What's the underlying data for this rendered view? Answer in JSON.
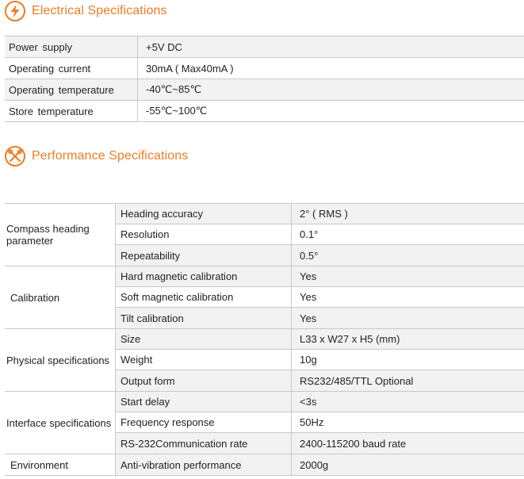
{
  "electrical": {
    "title": "Electrical Specifications",
    "icon": "lightning-icon",
    "rows": [
      {
        "label": "Power supply",
        "value": "+5V DC"
      },
      {
        "label": "Operating current",
        "value": "30mA ( Max40mA )"
      },
      {
        "label": "Operating temperature",
        "value": "-40℃~85℃"
      },
      {
        "label": "Store temperature",
        "value": "-55℃~100℃"
      }
    ]
  },
  "performance": {
    "title": "Performance Specifications",
    "icon": "tools-icon",
    "groups": [
      {
        "label": "Compass heading parameter",
        "rows": [
          {
            "name": "Heading accuracy",
            "value": "2° ( RMS )"
          },
          {
            "name": "Resolution",
            "value": "0.1°"
          },
          {
            "name": "Repeatability",
            "value": "0.5°"
          }
        ]
      },
      {
        "label": "Calibration",
        "rows": [
          {
            "name": "Hard magnetic calibration",
            "value": "Yes"
          },
          {
            "name": "Soft magnetic calibration",
            "value": "Yes"
          },
          {
            "name": "Tilt calibration",
            "value": "Yes"
          }
        ]
      },
      {
        "label": "Physical specifications",
        "rows": [
          {
            "name": "Size",
            "value": "L33 x W27 x H5 (mm)"
          },
          {
            "name": "Weight",
            "value": "10g"
          },
          {
            "name": "Output form",
            "value": "RS232/485/TTL Optional"
          }
        ]
      },
      {
        "label": "Interface specifications",
        "rows": [
          {
            "name": "Start delay",
            "value": "<3s"
          },
          {
            "name": "Frequency response",
            "value": "50Hz"
          },
          {
            "name": "RS-232Communication rate",
            "value": "2400-115200 baud rate"
          }
        ]
      },
      {
        "label": "Environment",
        "rows": [
          {
            "name": "Anti-vibration performance",
            "value": "2000g"
          }
        ]
      }
    ]
  },
  "colors": {
    "accent": "#ec7d23",
    "row_alt": "#f2f2f2",
    "border": "#c8c8c8"
  }
}
